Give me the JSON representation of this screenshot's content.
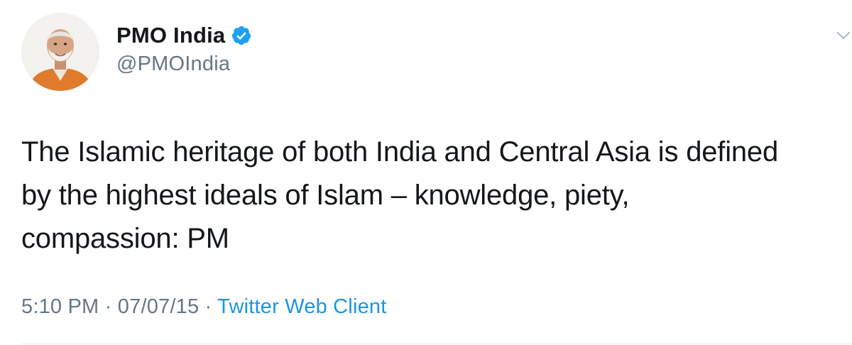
{
  "tweet": {
    "author": {
      "display_name": "PMO India",
      "handle": "@PMOIndia",
      "verified": true,
      "avatar_icon": "profile-photo"
    },
    "text": "The Islamic heritage of both India and Central Asia is defined\nby the highest ideals of Islam – knowledge, piety,\ncompassion: PM",
    "meta": {
      "time": "5:10 PM",
      "separator": " · ",
      "date": "07/07/15",
      "source": "Twitter Web Client"
    },
    "menu_icon": "chevron-down-icon"
  },
  "colors": {
    "text": "#14171a",
    "secondary": "#657786",
    "link": "#1b95e0",
    "verified_badge": "#1da1f2",
    "divider": "#e6ecf0"
  }
}
